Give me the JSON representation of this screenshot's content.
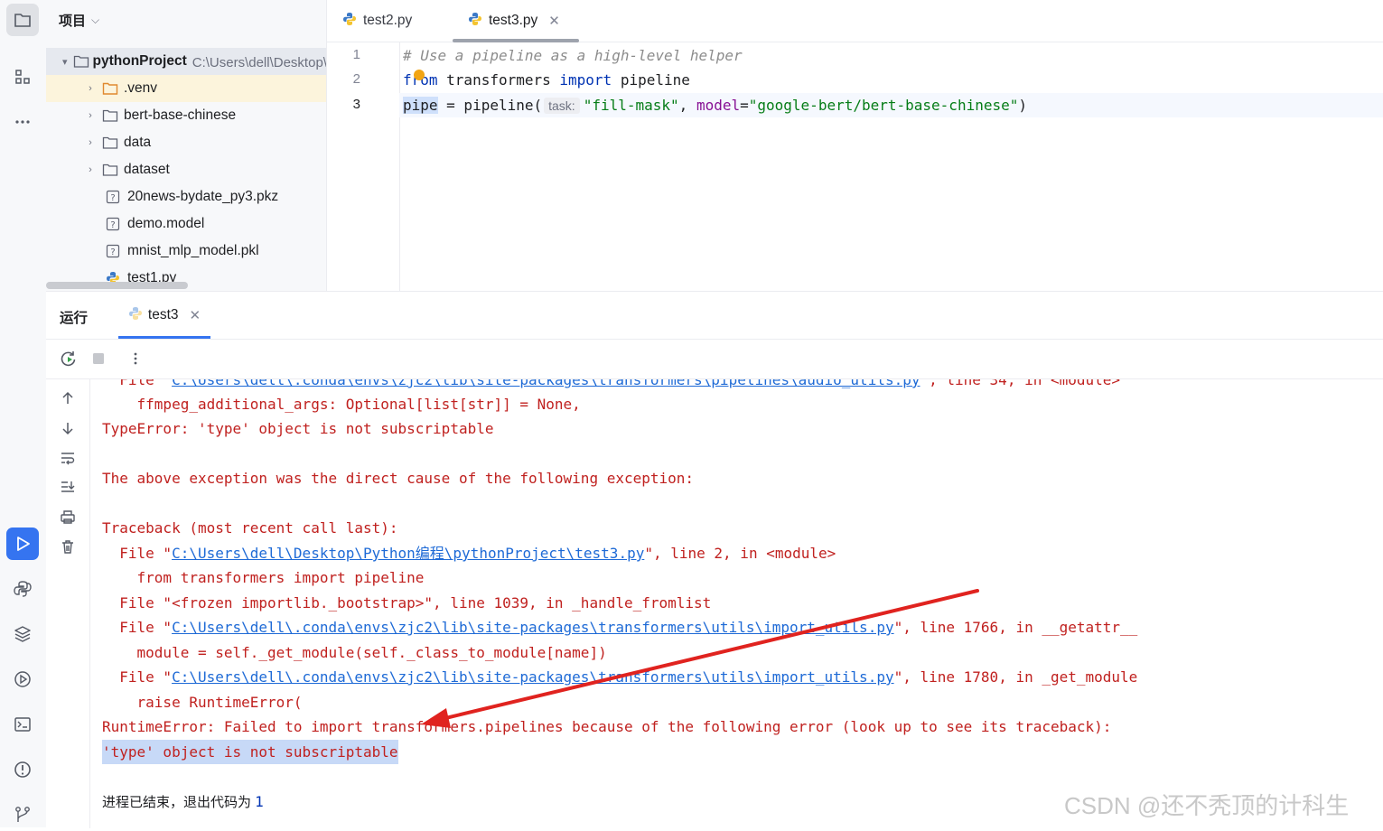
{
  "project_panel": {
    "title": "项目",
    "root": {
      "name": "pythonProject",
      "path": "C:\\Users\\dell\\Desktop\\Python编程\\pythonProject"
    },
    "items": [
      {
        "name": ".venv",
        "type": "folder-excluded",
        "expandable": true,
        "selected": true
      },
      {
        "name": "bert-base-chinese",
        "type": "folder",
        "expandable": true
      },
      {
        "name": "data",
        "type": "folder",
        "expandable": true
      },
      {
        "name": "dataset",
        "type": "folder",
        "expandable": true
      },
      {
        "name": "20news-bydate_py3.pkz",
        "type": "unknown-file"
      },
      {
        "name": "demo.model",
        "type": "unknown-file"
      },
      {
        "name": "mnist_mlp_model.pkl",
        "type": "unknown-file"
      },
      {
        "name": "test1.py",
        "type": "python-file"
      }
    ]
  },
  "editor": {
    "tabs": [
      {
        "label": "test2.py",
        "active": false
      },
      {
        "label": "test3.py",
        "active": true
      }
    ],
    "line_numbers": [
      "1",
      "2",
      "3"
    ],
    "code": {
      "line1_comment": "# Use a pipeline as a high-level helper",
      "line2_kw_from": "from",
      "line2_module": " transformers ",
      "line2_kw_import": "import",
      "line2_name": " pipeline",
      "line3_var": "pipe",
      "line3_call": " = pipeline(",
      "line3_hint": "task:",
      "line3_arg1": "\"fill-mask\"",
      "line3_comma": ", ",
      "line3_param": "model",
      "line3_eq": "=",
      "line3_arg2": "\"google-bert/bert-base-chinese\"",
      "line3_close": ")"
    }
  },
  "run_panel": {
    "title": "运行",
    "tab_label": "test3",
    "console": {
      "line_top_file_prefix": "  File \"",
      "line_top_file_link": "C:\\Users\\dell\\.conda\\envs\\zjc2\\lib\\site-packages\\transformers\\pipelines\\audio_utils.py",
      "line_top_file_suffix": "\", line 34, in <module>",
      "l1": "    ffmpeg_additional_args: Optional[list[str]] = None,",
      "l2": "TypeError: 'type' object is not subscriptable",
      "l3": "The above exception was the direct cause of the following exception:",
      "l4": "Traceback (most recent call last):",
      "l5_prefix": "  File \"",
      "l5_link": "C:\\Users\\dell\\Desktop\\Python编程\\pythonProject\\test3.py",
      "l5_suffix": "\", line 2, in <module>",
      "l6": "    from transformers import pipeline",
      "l7": "  File \"<frozen importlib._bootstrap>\", line 1039, in _handle_fromlist",
      "l8_prefix": "  File \"",
      "l8_link": "C:\\Users\\dell\\.conda\\envs\\zjc2\\lib\\site-packages\\transformers\\utils\\import_utils.py",
      "l8_suffix": "\", line 1766, in __getattr__",
      "l9": "    module = self._get_module(self._class_to_module[name])",
      "l10_prefix": "  File \"",
      "l10_link": "C:\\Users\\dell\\.conda\\envs\\zjc2\\lib\\site-packages\\transformers\\utils\\import_utils.py",
      "l10_suffix": "\", line 1780, in _get_module",
      "l11": "    raise RuntimeError(",
      "l12": "RuntimeError: Failed to import transformers.pipelines because of the following error (look up to see its traceback):",
      "l13": "'type' object is not subscriptable",
      "exit_text": "进程已结束，退出代码为 ",
      "exit_code": "1"
    }
  },
  "watermark": "CSDN @还不秃顶的计科生",
  "colors": {
    "accent_blue": "#3574f0",
    "error_red": "#c0211f",
    "link_blue": "#1e6ad6",
    "annotation_arrow": "#e0231f"
  },
  "icons": {
    "left_strip": [
      "folder-icon",
      "structure-icon",
      "more-icon",
      "run-icon",
      "python-console-icon",
      "layers-icon",
      "services-icon",
      "terminal-icon",
      "problems-icon",
      "git-icon"
    ],
    "run_toolbar": [
      "rerun-icon",
      "stop-icon",
      "more-vertical-icon"
    ],
    "console_side": [
      "scroll-up-icon",
      "scroll-down-icon",
      "soft-wrap-icon",
      "scroll-to-end-icon",
      "print-icon",
      "trash-icon"
    ]
  }
}
